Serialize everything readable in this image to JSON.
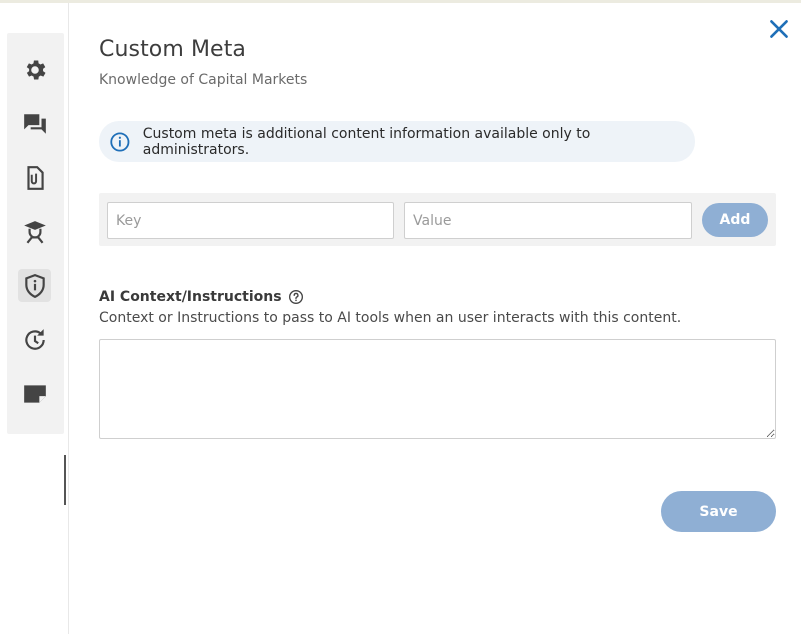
{
  "sidebar": {
    "items": [
      {
        "icon": "gear-icon"
      },
      {
        "icon": "chat-bubbles-icon"
      },
      {
        "icon": "paperclip-document-icon"
      },
      {
        "icon": "graduate-icon"
      },
      {
        "icon": "shield-info-icon",
        "active": true
      },
      {
        "icon": "history-icon"
      },
      {
        "icon": "folded-note-icon"
      }
    ]
  },
  "dialog": {
    "title": "Custom Meta",
    "subtitle": "Knowledge of Capital Markets",
    "info_text": "Custom meta is additional content information available only to administrators.",
    "key_placeholder": "Key",
    "value_placeholder": "Value",
    "add_label": "Add",
    "ai_label": "AI Context/Instructions",
    "ai_description": "Context or Instructions to pass to AI tools when an user interacts with this content.",
    "ai_value": "",
    "save_label": "Save"
  },
  "colors": {
    "accent": "#1f6fb8",
    "button_disabled": "#8fafd4",
    "info_bg": "#eef3f8",
    "rail_bg": "#f2f2f2"
  }
}
